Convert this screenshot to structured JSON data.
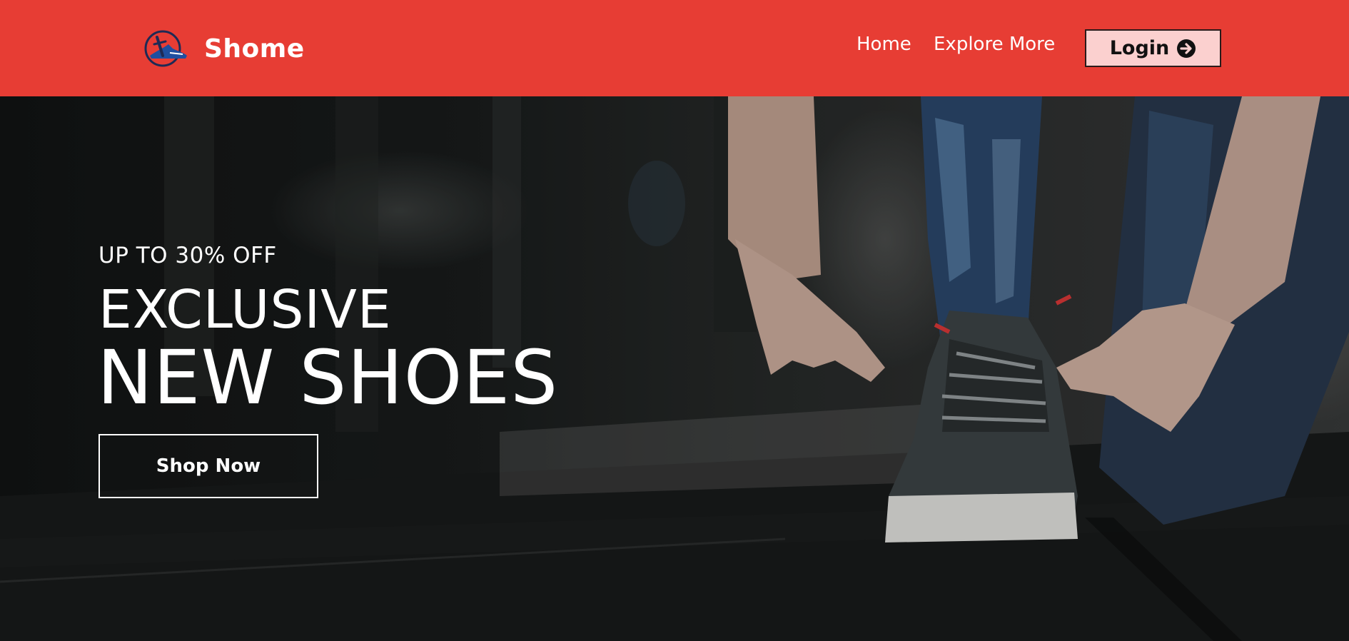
{
  "header": {
    "brand_name": "Shome",
    "logo_icon": "shoe-logo-icon",
    "nav": {
      "home": "Home",
      "explore": "Explore More"
    },
    "login": {
      "label": "Login",
      "icon": "arrow-right-circle-icon"
    }
  },
  "hero": {
    "promo": "UP TO 30% OFF",
    "headline_line1": "EXCLUSIVE",
    "headline_line2": "NEW SHOES",
    "cta_label": "Shop Now",
    "image": "photo-person-tying-sneaker-laces"
  },
  "colors": {
    "header_bg": "#e73d34",
    "login_bg": "#fbd0cf",
    "text_light": "#ffffff",
    "hero_dark": "#1a1c1c"
  }
}
